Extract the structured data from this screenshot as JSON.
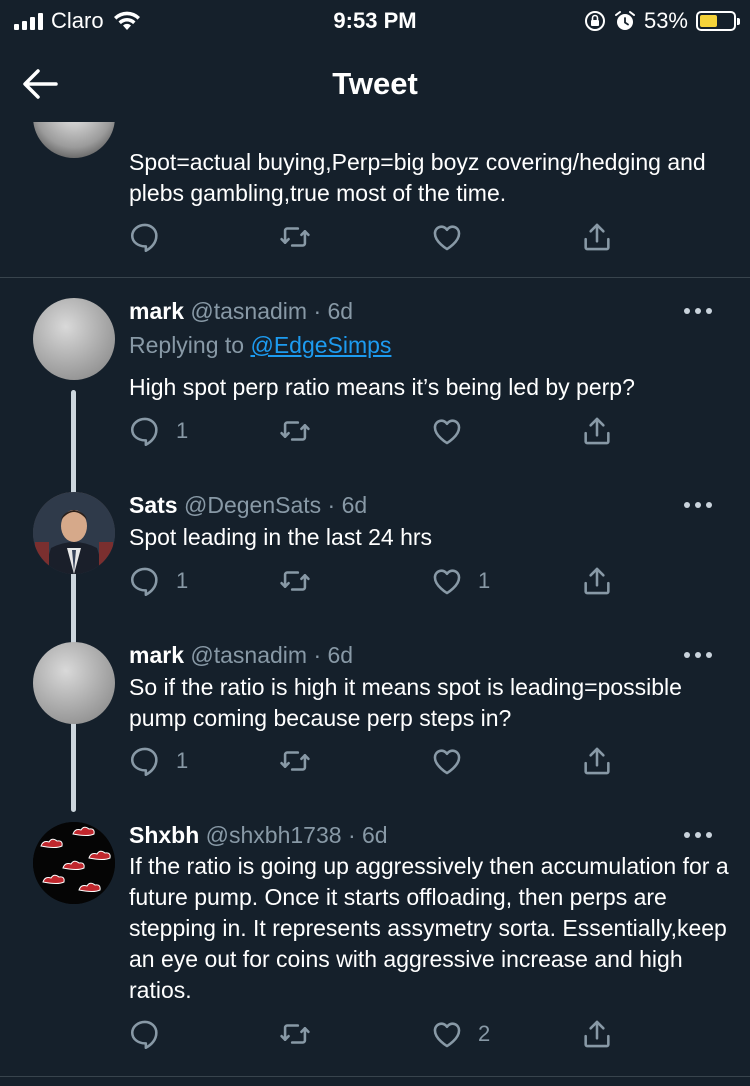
{
  "status_bar": {
    "carrier": "Claro",
    "time": "9:53 PM",
    "battery_percent": "53%",
    "battery_level": 0.53
  },
  "nav": {
    "title": "Tweet"
  },
  "top_tweet": {
    "text": "Spot=actual buying,Perp=big boyz covering/hedging and plebs gambling,true most of the time."
  },
  "tweets": [
    {
      "name": "mark",
      "handle": "@tasnadim · 6d",
      "replying_prefix": "Replying to ",
      "replying_handle": "@EdgeSimps",
      "text": "High spot perp ratio means it’s being led by perp?",
      "reply_count": "1",
      "like_count": ""
    },
    {
      "name": "Sats",
      "handle": "@DegenSats · 6d",
      "text": "Spot leading in the last 24 hrs",
      "reply_count": "1",
      "like_count": "1"
    },
    {
      "name": "mark",
      "handle": "@tasnadim · 6d",
      "text": "So if the ratio is high it means spot is leading=possible pump coming because perp steps in?",
      "reply_count": "1",
      "like_count": ""
    },
    {
      "name": "Shxbh",
      "handle": "@shxbh1738 · 6d",
      "text": "If the ratio is going up aggressively then accumulation for a future pump. Once it starts offloading, then perps are stepping in. It represents assymetry sorta. Essentially,keep an eye out for coins with aggressive increase and high ratios.",
      "reply_count": "",
      "like_count": "2"
    }
  ],
  "colors": {
    "background": "#15202b",
    "secondary_text": "#8899a6",
    "link": "#1d9bf0",
    "divider": "#38444d"
  }
}
